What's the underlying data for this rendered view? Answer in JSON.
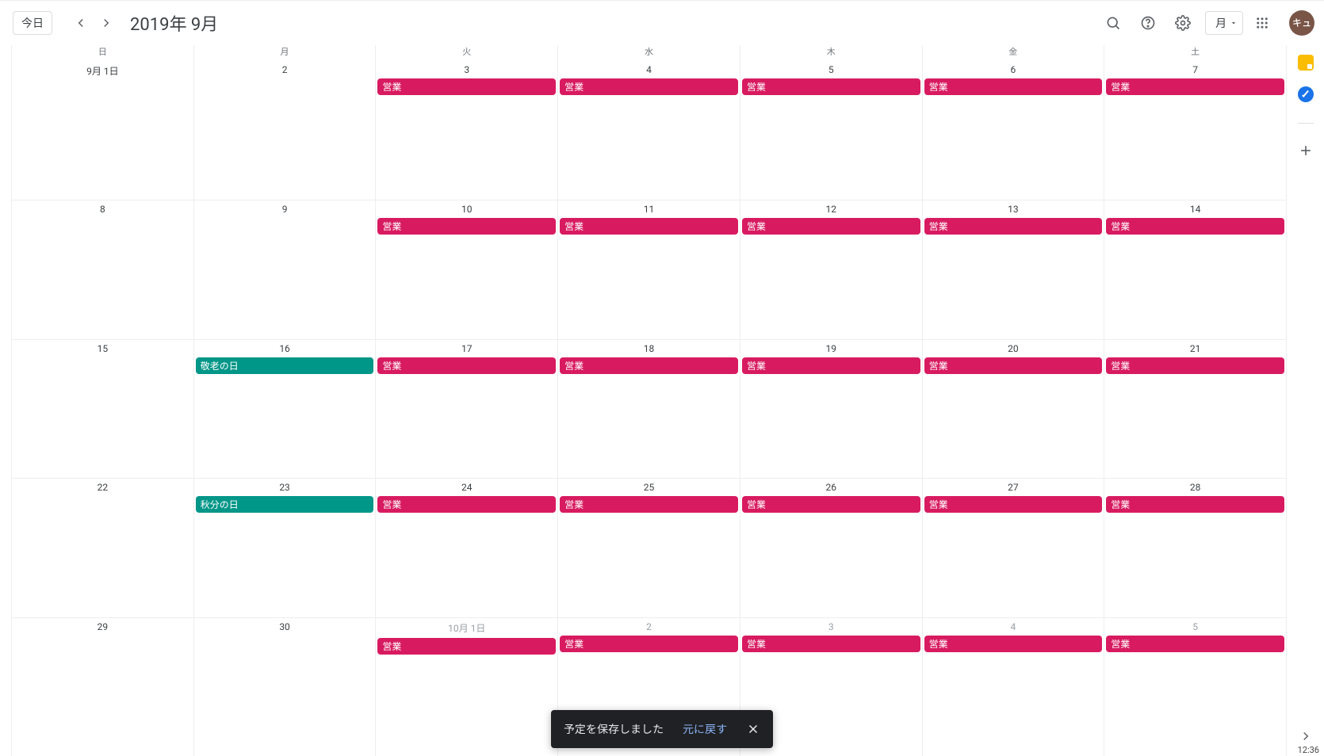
{
  "header": {
    "today_label": "今日",
    "title": "2019年 9月",
    "view_label": "月",
    "avatar_text": "キュ"
  },
  "weekdays": [
    "日",
    "月",
    "火",
    "水",
    "木",
    "金",
    "土"
  ],
  "weeks": [
    [
      {
        "label": "9月 1日",
        "other": false,
        "events": []
      },
      {
        "label": "2",
        "other": false,
        "events": []
      },
      {
        "label": "3",
        "other": false,
        "events": [
          {
            "title": "営業",
            "color": "pink"
          }
        ]
      },
      {
        "label": "4",
        "other": false,
        "events": [
          {
            "title": "営業",
            "color": "pink"
          }
        ]
      },
      {
        "label": "5",
        "other": false,
        "events": [
          {
            "title": "営業",
            "color": "pink"
          }
        ]
      },
      {
        "label": "6",
        "other": false,
        "events": [
          {
            "title": "営業",
            "color": "pink"
          }
        ]
      },
      {
        "label": "7",
        "other": false,
        "events": [
          {
            "title": "営業",
            "color": "pink"
          }
        ]
      }
    ],
    [
      {
        "label": "8",
        "other": false,
        "events": []
      },
      {
        "label": "9",
        "other": false,
        "events": []
      },
      {
        "label": "10",
        "other": false,
        "events": [
          {
            "title": "営業",
            "color": "pink"
          }
        ]
      },
      {
        "label": "11",
        "other": false,
        "events": [
          {
            "title": "営業",
            "color": "pink"
          }
        ]
      },
      {
        "label": "12",
        "other": false,
        "events": [
          {
            "title": "営業",
            "color": "pink"
          }
        ]
      },
      {
        "label": "13",
        "other": false,
        "events": [
          {
            "title": "営業",
            "color": "pink"
          }
        ]
      },
      {
        "label": "14",
        "other": false,
        "events": [
          {
            "title": "営業",
            "color": "pink"
          }
        ]
      }
    ],
    [
      {
        "label": "15",
        "other": false,
        "events": []
      },
      {
        "label": "16",
        "other": false,
        "events": [
          {
            "title": "敬老の日",
            "color": "teal"
          }
        ]
      },
      {
        "label": "17",
        "other": false,
        "events": [
          {
            "title": "営業",
            "color": "pink"
          }
        ]
      },
      {
        "label": "18",
        "other": false,
        "events": [
          {
            "title": "営業",
            "color": "pink"
          }
        ]
      },
      {
        "label": "19",
        "other": false,
        "events": [
          {
            "title": "営業",
            "color": "pink"
          }
        ]
      },
      {
        "label": "20",
        "other": false,
        "events": [
          {
            "title": "営業",
            "color": "pink"
          }
        ]
      },
      {
        "label": "21",
        "other": false,
        "events": [
          {
            "title": "営業",
            "color": "pink"
          }
        ]
      }
    ],
    [
      {
        "label": "22",
        "other": false,
        "events": []
      },
      {
        "label": "23",
        "other": false,
        "events": [
          {
            "title": "秋分の日",
            "color": "teal"
          }
        ]
      },
      {
        "label": "24",
        "other": false,
        "events": [
          {
            "title": "営業",
            "color": "pink"
          }
        ]
      },
      {
        "label": "25",
        "other": false,
        "events": [
          {
            "title": "営業",
            "color": "pink"
          }
        ]
      },
      {
        "label": "26",
        "other": false,
        "events": [
          {
            "title": "営業",
            "color": "pink"
          }
        ]
      },
      {
        "label": "27",
        "other": false,
        "events": [
          {
            "title": "営業",
            "color": "pink"
          }
        ]
      },
      {
        "label": "28",
        "other": false,
        "events": [
          {
            "title": "営業",
            "color": "pink"
          }
        ]
      }
    ],
    [
      {
        "label": "29",
        "other": false,
        "events": []
      },
      {
        "label": "30",
        "other": false,
        "events": []
      },
      {
        "label": "10月 1日",
        "other": true,
        "events": [
          {
            "title": "営業",
            "color": "pink"
          }
        ]
      },
      {
        "label": "2",
        "other": true,
        "events": [
          {
            "title": "営業",
            "color": "pink"
          }
        ]
      },
      {
        "label": "3",
        "other": true,
        "events": [
          {
            "title": "営業",
            "color": "pink"
          }
        ]
      },
      {
        "label": "4",
        "other": true,
        "events": [
          {
            "title": "営業",
            "color": "pink"
          }
        ]
      },
      {
        "label": "5",
        "other": true,
        "events": [
          {
            "title": "営業",
            "color": "pink"
          }
        ]
      }
    ]
  ],
  "toast": {
    "message": "予定を保存しました",
    "undo_label": "元に戻す"
  },
  "clock": "12:36"
}
